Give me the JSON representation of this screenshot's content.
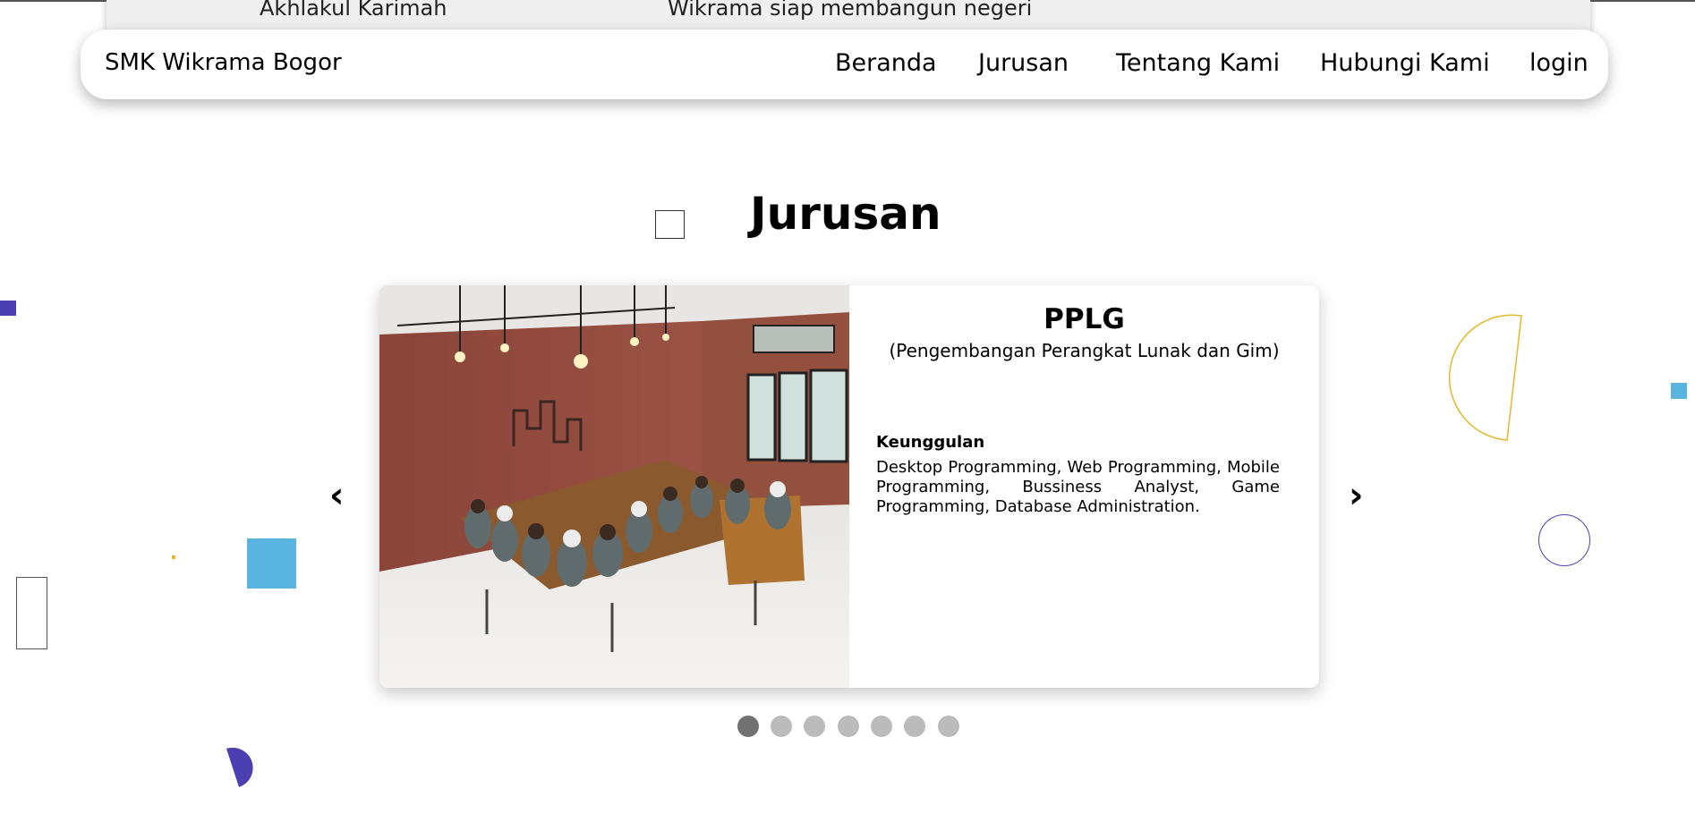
{
  "top_panel": {
    "left_text": "Akhlakul Karimah",
    "right_text": "Wikrama siap membangun negeri"
  },
  "navbar": {
    "brand": "SMK Wikrama Bogor",
    "links": [
      "Beranda",
      "Jurusan",
      "Tentang Kami",
      "Hubungi Kami",
      "login"
    ]
  },
  "section": {
    "title": "Jurusan"
  },
  "slide": {
    "title": "PPLG",
    "subtitle": "(Pengembangan Perangkat Lunak dan Gim)",
    "heading": "Keunggulan",
    "description": "Desktop Programming, Web Programming, Mobile Programming, Bussiness Analyst, Game Programming, Database Administration."
  },
  "carousel": {
    "prev_label": "‹",
    "next_label": "›",
    "slide_count": 7,
    "active_index": 0
  },
  "colors": {
    "accent_purple": "#4b3fb1",
    "accent_blue": "#5ab4e0",
    "accent_yellow": "#e3b82a"
  }
}
